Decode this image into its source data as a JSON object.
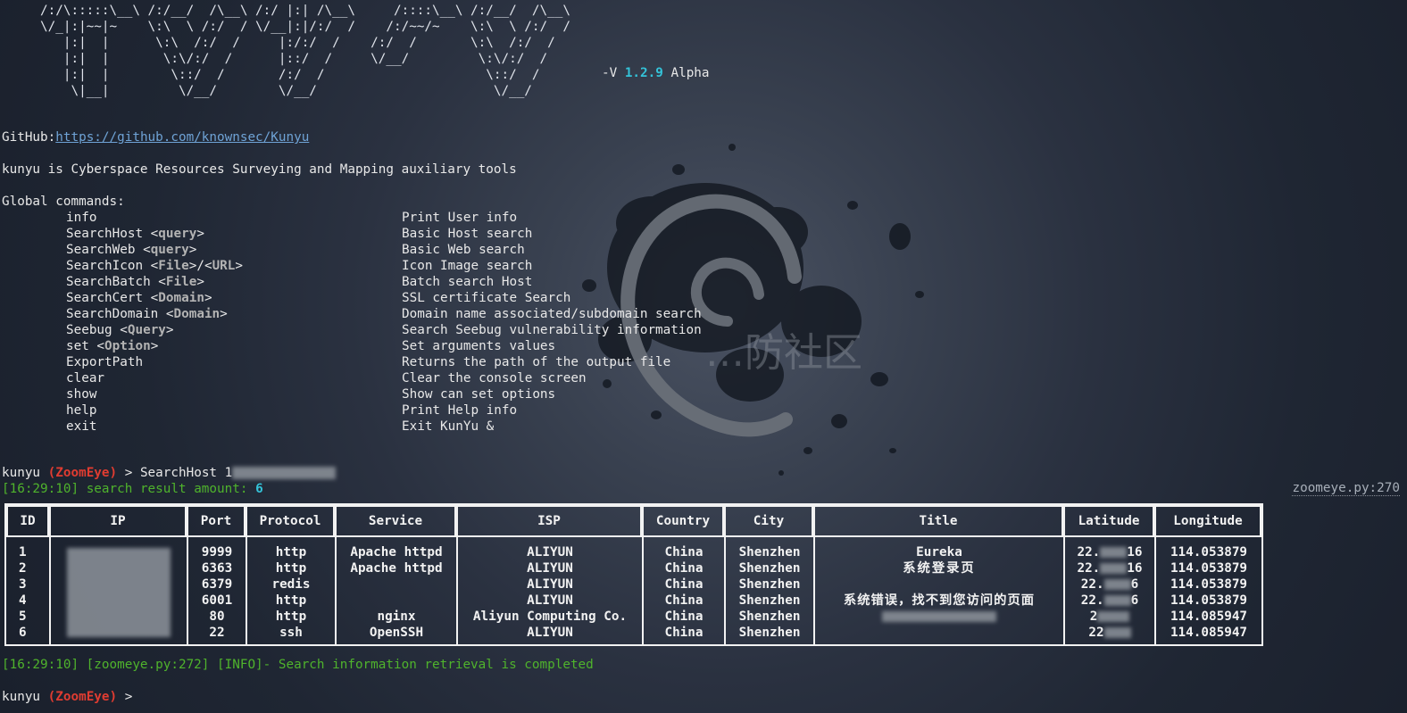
{
  "banner": {
    "ascii_lines": [
      "     /:/\\:::::\\__\\ /:/__/  /\\__\\ /:/ |:| /\\__\\     /::::\\__\\ /:/__/  /\\__\\",
      "     \\/_|:|~~|~    \\:\\  \\ /:/  / \\/__|:|/:/  /    /:/~~/~    \\:\\  \\ /:/  /",
      "        |:|  |      \\:\\  /:/  /     |:/:/  /    /:/  /       \\:\\  /:/  /",
      "        |:|  |       \\:\\/:/  /      |::/  /     \\/__/         \\:\\/:/  /",
      "        |:|  |        \\::/  /       /:/  /                     \\::/  /",
      "         \\|__|         \\/__/        \\/__/                       \\/__/"
    ],
    "version_prefix": "-V ",
    "version": "1.2.9",
    "version_suffix": " Alpha"
  },
  "github_label": "GitHub:",
  "github_url": "https://github.com/knownsec/Kunyu",
  "tagline": "kunyu is Cyberspace Resources Surveying and Mapping auxiliary tools",
  "global_commands_label": "Global commands:",
  "commands": [
    {
      "name": "info",
      "desc": "Print User info"
    },
    {
      "name": "SearchHost",
      "arg": "query",
      "desc": "Basic Host search"
    },
    {
      "name": "SearchWeb",
      "arg": "query",
      "desc": "Basic Web search"
    },
    {
      "name": "SearchIcon",
      "arg": "File",
      "arg2": "URL",
      "desc": "Icon Image search"
    },
    {
      "name": "SearchBatch",
      "arg": "File",
      "desc": "Batch search Host"
    },
    {
      "name": "SearchCert",
      "arg": "Domain",
      "desc": "SSL certificate Search"
    },
    {
      "name": "SearchDomain",
      "arg": "Domain",
      "desc": "Domain name associated/subdomain search"
    },
    {
      "name": "Seebug",
      "arg": "Query",
      "desc": "Search Seebug vulnerability information"
    },
    {
      "name": "set",
      "arg": "Option",
      "desc": "Set arguments values"
    },
    {
      "name": "ExportPath",
      "desc": "Returns the path of the output file"
    },
    {
      "name": "clear",
      "desc": "Clear the console screen"
    },
    {
      "name": "show",
      "desc": "Show can set options"
    },
    {
      "name": "help",
      "desc": "Print Help info"
    },
    {
      "name": "exit",
      "desc": "Exit KunYu &"
    }
  ],
  "prompt": {
    "name": "kunyu",
    "engine": "(ZoomEye)",
    "symbol": ">",
    "entered_command": "SearchHost 1"
  },
  "result_log": {
    "time": "[16:29:10]",
    "text": "search result amount:",
    "amount": "6",
    "source_ref": "zoomeye.py:270"
  },
  "table": {
    "headers": [
      "ID",
      "IP",
      "Port",
      "Protocol",
      "Service",
      "ISP",
      "Country",
      "City",
      "Title",
      "Latitude",
      "Longitude"
    ],
    "rows": [
      {
        "id": "1",
        "port": "9999",
        "protocol": "http",
        "service": "Apache httpd",
        "isp": "ALIYUN",
        "country": "China",
        "city": "Shenzhen",
        "title": "Eureka",
        "lat_start": "22.",
        "lat_end": "16",
        "longitude": "114.053879"
      },
      {
        "id": "2",
        "port": "6363",
        "protocol": "http",
        "service": "Apache httpd",
        "isp": "ALIYUN",
        "country": "China",
        "city": "Shenzhen",
        "title": "系统登录页",
        "lat_start": "22.",
        "lat_end": "16",
        "longitude": "114.053879"
      },
      {
        "id": "3",
        "port": "6379",
        "protocol": "redis",
        "service": "",
        "isp": "ALIYUN",
        "country": "China",
        "city": "Shenzhen",
        "title": "",
        "lat_start": "22.",
        "lat_end": "6",
        "longitude": "114.053879"
      },
      {
        "id": "4",
        "port": "6001",
        "protocol": "http",
        "service": "",
        "isp": "ALIYUN",
        "country": "China",
        "city": "Shenzhen",
        "title": "系统错误，找不到您访问的页面",
        "lat_start": "22.",
        "lat_end": "6",
        "longitude": "114.053879"
      },
      {
        "id": "5",
        "port": "80",
        "protocol": "http",
        "service": "nginx",
        "isp": "Aliyun Computing Co.",
        "country": "China",
        "city": "Shenzhen",
        "title": "",
        "lat_start": "2",
        "lat_end": "",
        "longitude": "114.085947"
      },
      {
        "id": "6",
        "port": "22",
        "protocol": "ssh",
        "service": "OpenSSH",
        "isp": "ALIYUN",
        "country": "China",
        "city": "Shenzhen",
        "title": "",
        "lat_start": "22",
        "lat_end": "",
        "longitude": "114.085947"
      }
    ]
  },
  "info_log": "[16:29:10] [zoomeye.py:272] [INFO]- Search information retrieval is completed",
  "watermark_text": "…防社区",
  "colors": {
    "background": "#2a3140",
    "accent_cyan": "#34c3d9",
    "prompt_red": "#e03c31",
    "log_green": "#4fb32c",
    "link_blue": "#6fa3d6"
  }
}
